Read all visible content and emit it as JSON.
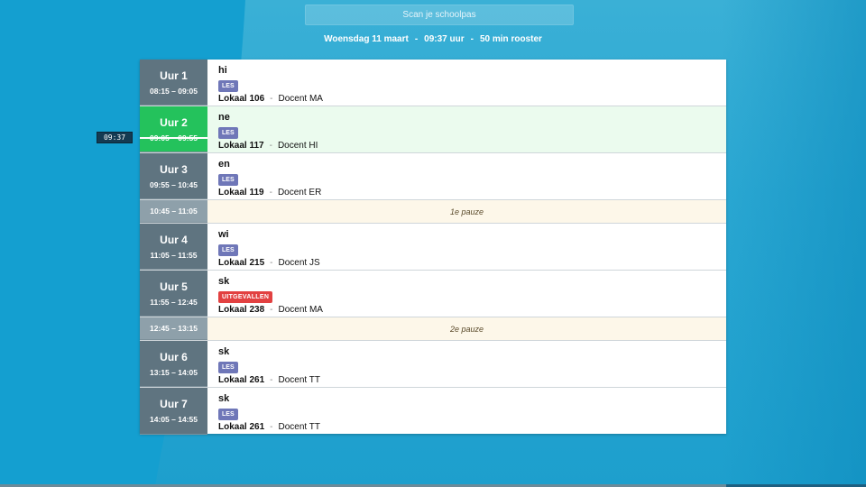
{
  "scan_placeholder": "Scan je schoolpas",
  "header": {
    "date": "Woensdag 11 maart",
    "time": "09:37 uur",
    "schedule": "50 min rooster",
    "separator": "-"
  },
  "now_marker": "09:37",
  "rows": [
    {
      "type": "lesson",
      "period": "Uur 1",
      "time": "08:15 – 09:05",
      "subject": "hi",
      "badge": "LES",
      "room": "Lokaal 106",
      "teacher": "Docent MA"
    },
    {
      "type": "lesson",
      "period": "Uur 2",
      "time": "09:05 – 09:55",
      "subject": "ne",
      "badge": "LES",
      "room": "Lokaal 117",
      "teacher": "Docent HI",
      "active": true
    },
    {
      "type": "lesson",
      "period": "Uur 3",
      "time": "09:55 – 10:45",
      "subject": "en",
      "badge": "LES",
      "room": "Lokaal 119",
      "teacher": "Docent ER"
    },
    {
      "type": "pause",
      "time": "10:45 – 11:05",
      "label": "1e pauze"
    },
    {
      "type": "lesson",
      "period": "Uur 4",
      "time": "11:05 – 11:55",
      "subject": "wi",
      "badge": "LES",
      "room": "Lokaal 215",
      "teacher": "Docent JS"
    },
    {
      "type": "lesson",
      "period": "Uur 5",
      "time": "11:55 – 12:45",
      "subject": "sk",
      "badge": "UITGEVALLEN",
      "room": "Lokaal 238",
      "teacher": "Docent MA",
      "cancelled": true
    },
    {
      "type": "pause",
      "time": "12:45 – 13:15",
      "label": "2e pauze"
    },
    {
      "type": "lesson",
      "period": "Uur 6",
      "time": "13:15 – 14:05",
      "subject": "sk",
      "badge": "LES",
      "room": "Lokaal 261",
      "teacher": "Docent TT"
    },
    {
      "type": "lesson",
      "period": "Uur 7",
      "time": "14:05 – 14:55",
      "subject": "sk",
      "badge": "LES",
      "room": "Lokaal 261",
      "teacher": "Docent TT"
    }
  ],
  "colors": {
    "active": "#24c25c",
    "period_bg": "#5f7480",
    "badge_les": "#6f77b8",
    "badge_cancel": "#e24141",
    "pause_bg": "#fdf7e9"
  }
}
